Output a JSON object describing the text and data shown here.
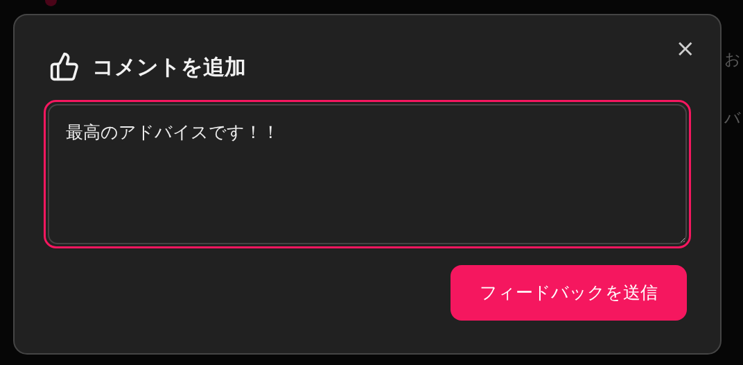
{
  "background": {
    "texts": [
      "お",
      "バ"
    ]
  },
  "dialog": {
    "title": "コメントを追加",
    "close": "×",
    "comment": {
      "value": "最高のアドバイスです！！"
    },
    "submit_button": "フィードバックを送信"
  }
}
